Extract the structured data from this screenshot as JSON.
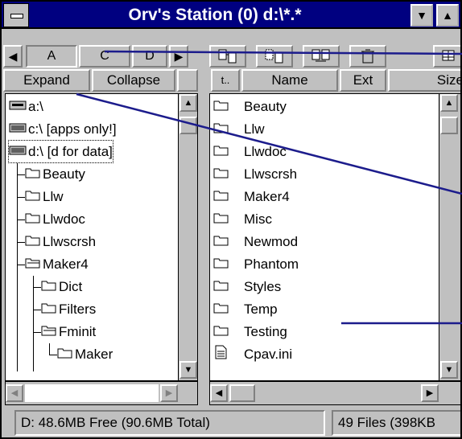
{
  "window": {
    "title": "Orv's Station (0) d:\\*.*"
  },
  "drive_tabs": [
    "A",
    "C",
    "D"
  ],
  "tree_header": {
    "expand": "Expand",
    "collapse": "Collapse"
  },
  "file_header": {
    "sort": "t..",
    "name": "Name",
    "ext": "Ext",
    "size": "Size"
  },
  "tree": [
    {
      "label": "a:\\",
      "icon": "floppy-drive-icon"
    },
    {
      "label": "c:\\ [apps only!]",
      "icon": "hard-drive-icon"
    },
    {
      "label": "d:\\ [d for data]",
      "icon": "hard-drive-icon"
    },
    {
      "label": "Beauty",
      "icon": "folder-icon"
    },
    {
      "label": "Llw",
      "icon": "folder-icon"
    },
    {
      "label": "Llwdoc",
      "icon": "folder-icon"
    },
    {
      "label": "Llwscrsh",
      "icon": "folder-icon"
    },
    {
      "label": "Maker4",
      "icon": "folder-open-icon"
    },
    {
      "label": "Dict",
      "icon": "folder-icon"
    },
    {
      "label": "Filters",
      "icon": "folder-icon"
    },
    {
      "label": "Fminit",
      "icon": "folder-open-icon"
    },
    {
      "label": "Maker",
      "icon": "folder-icon"
    }
  ],
  "files": [
    {
      "name": "Beauty",
      "icon": "folder-icon"
    },
    {
      "name": "Llw",
      "icon": "folder-icon"
    },
    {
      "name": "Llwdoc",
      "icon": "folder-icon"
    },
    {
      "name": "Llwscrsh",
      "icon": "folder-icon"
    },
    {
      "name": "Maker4",
      "icon": "folder-icon"
    },
    {
      "name": "Misc",
      "icon": "folder-icon"
    },
    {
      "name": "Newmod",
      "icon": "folder-icon"
    },
    {
      "name": "Phantom",
      "icon": "folder-icon"
    },
    {
      "name": "Styles",
      "icon": "folder-icon"
    },
    {
      "name": "Temp",
      "icon": "folder-icon"
    },
    {
      "name": "Testing",
      "icon": "folder-icon"
    },
    {
      "name": "Cpav.ini",
      "icon": "document-icon"
    }
  ],
  "status": {
    "free": "D: 48.6MB Free (90.6MB Total)",
    "files": "49 Files (398KB"
  },
  "colors": {
    "titlebar": "#000080",
    "callout": "#1c1c8c"
  }
}
